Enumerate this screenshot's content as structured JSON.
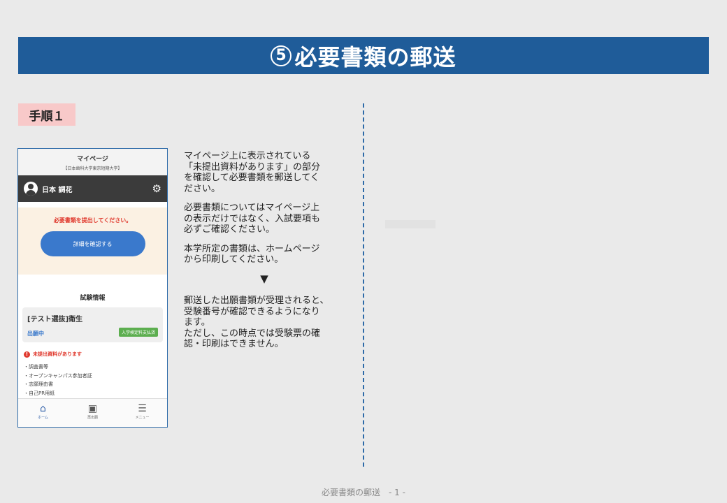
{
  "title": {
    "number": "5",
    "text": "必要書類の郵送"
  },
  "step_label": "手順１",
  "phone": {
    "header_title": "マイページ",
    "header_subtitle": "【日本歯科大学東京短期大学】",
    "user_name": "日本 調花",
    "notice_text": "必要書類を提出してください。",
    "notice_button": "詳細を確認する",
    "section_title": "試験情報",
    "exam_name": "[テスト選抜]衛生",
    "exam_status": "出願中",
    "exam_badge": "入学検定料支払済",
    "alert_text": "未提出資料があります",
    "documents": [
      "・調査書等",
      "・オープンキャンパス参加者証",
      "・志願理由書",
      "・自己PR用紙"
    ],
    "nav": {
      "home": "ホーム",
      "reissue": "再出願",
      "menu": "メニュー"
    }
  },
  "description": {
    "p1": "マイページ上に表示されている\n「未提出資料があります」の部分\nを確認して必要書類を郵送してく\nださい。",
    "p2": "必要書類についてはマイページ上\nの表示だけではなく、入試要項も\n必ずご確認ください。",
    "p3": "本学所定の書類は、ホームページ\nから印刷してください。",
    "arrow": "▼",
    "p4": "郵送した出願書類が受理されると、\n受験番号が確認できるようになり\nます。\nただし、この時点では受験票の確\n認・印刷はできません。"
  },
  "footer": "必要書類の郵送　- 1 -"
}
